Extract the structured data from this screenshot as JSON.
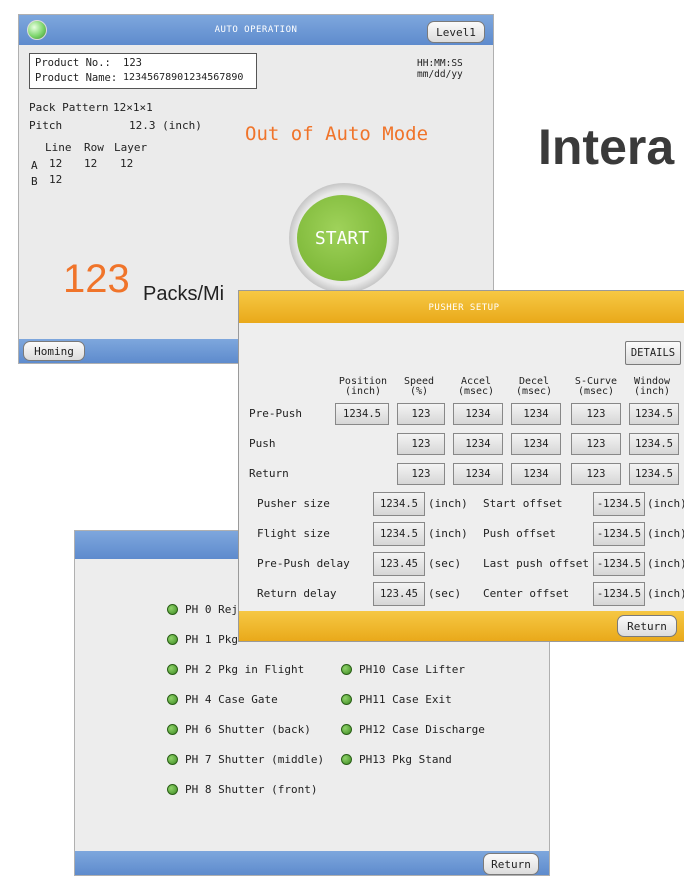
{
  "heading_text": "Intera",
  "auto": {
    "title": "AUTO OPERATION",
    "level_button": "Level1",
    "product_no_label": "Product No.:",
    "product_no_value": "123",
    "product_name_label": "Product Name:",
    "product_name_value": "12345678901234567890",
    "time": "HH:MM:SS",
    "date": "mm/dd/yy",
    "pack_pattern_label": "Pack Pattern",
    "pack_pattern_value": "12×1×1",
    "pitch_label": "Pitch",
    "pitch_value": "12.3 (inch)",
    "mode_status": "Out of Auto Mode",
    "table_headers": [
      "Line",
      "Row",
      "Layer"
    ],
    "rows": [
      {
        "label": "A",
        "line": "12",
        "row": "12",
        "layer": "12"
      },
      {
        "label": "B",
        "line": "12"
      }
    ],
    "start_button": "START",
    "rate_value": "123",
    "rate_unit": "Packs/Mi",
    "homing_button": "Homing",
    "status_color": "#f0742a",
    "start_color": "#8cc63f"
  },
  "pusher": {
    "title": "PUSHER SETUP",
    "details_button": "DETAILS",
    "columns": [
      "Position\n(inch)",
      "Speed\n(%)",
      "Accel\n(msec)",
      "Decel\n(msec)",
      "S-Curve\n(msec)",
      "Window\n(inch)"
    ],
    "rows": [
      {
        "label": "Pre-Push",
        "values": [
          "1234.5",
          "123",
          "1234",
          "1234",
          "123",
          "1234.5"
        ]
      },
      {
        "label": "Push",
        "values": [
          "",
          "123",
          "1234",
          "1234",
          "123",
          "1234.5"
        ]
      },
      {
        "label": "Return",
        "values": [
          "",
          "123",
          "1234",
          "1234",
          "123",
          "1234.5"
        ]
      }
    ],
    "params_left": [
      {
        "label": "Pusher size",
        "value": "1234.5",
        "unit": "(inch)"
      },
      {
        "label": "Flight size",
        "value": "1234.5",
        "unit": "(inch)"
      },
      {
        "label": "Pre-Push delay",
        "value": "123.45",
        "unit": "(sec)"
      },
      {
        "label": "Return delay",
        "value": "123.45",
        "unit": "(sec)"
      }
    ],
    "params_right": [
      {
        "label": "Start offset",
        "value": "-1234.5",
        "unit": "(inch)"
      },
      {
        "label": "Push offset",
        "value": "-1234.5",
        "unit": "(inch)"
      },
      {
        "label": "Last push offset",
        "value": "-1234.5",
        "unit": "(inch)"
      },
      {
        "label": "Center offset",
        "value": "-1234.5",
        "unit": "(inch)"
      }
    ],
    "return_button": "Return"
  },
  "sensors": {
    "left": [
      "PH 0 Rej",
      "PH 1 Pkg",
      "PH 2 Pkg in Flight",
      "PH 4 Case Gate",
      "PH 6 Shutter (back)",
      "PH 7 Shutter (middle)",
      "PH 8 Shutter (front)"
    ],
    "right": [
      "PH10 Case Lifter",
      "PH11 Case Exit",
      "PH12 Case Discharge",
      "PH13 Pkg Stand"
    ],
    "return_button": "Return"
  }
}
